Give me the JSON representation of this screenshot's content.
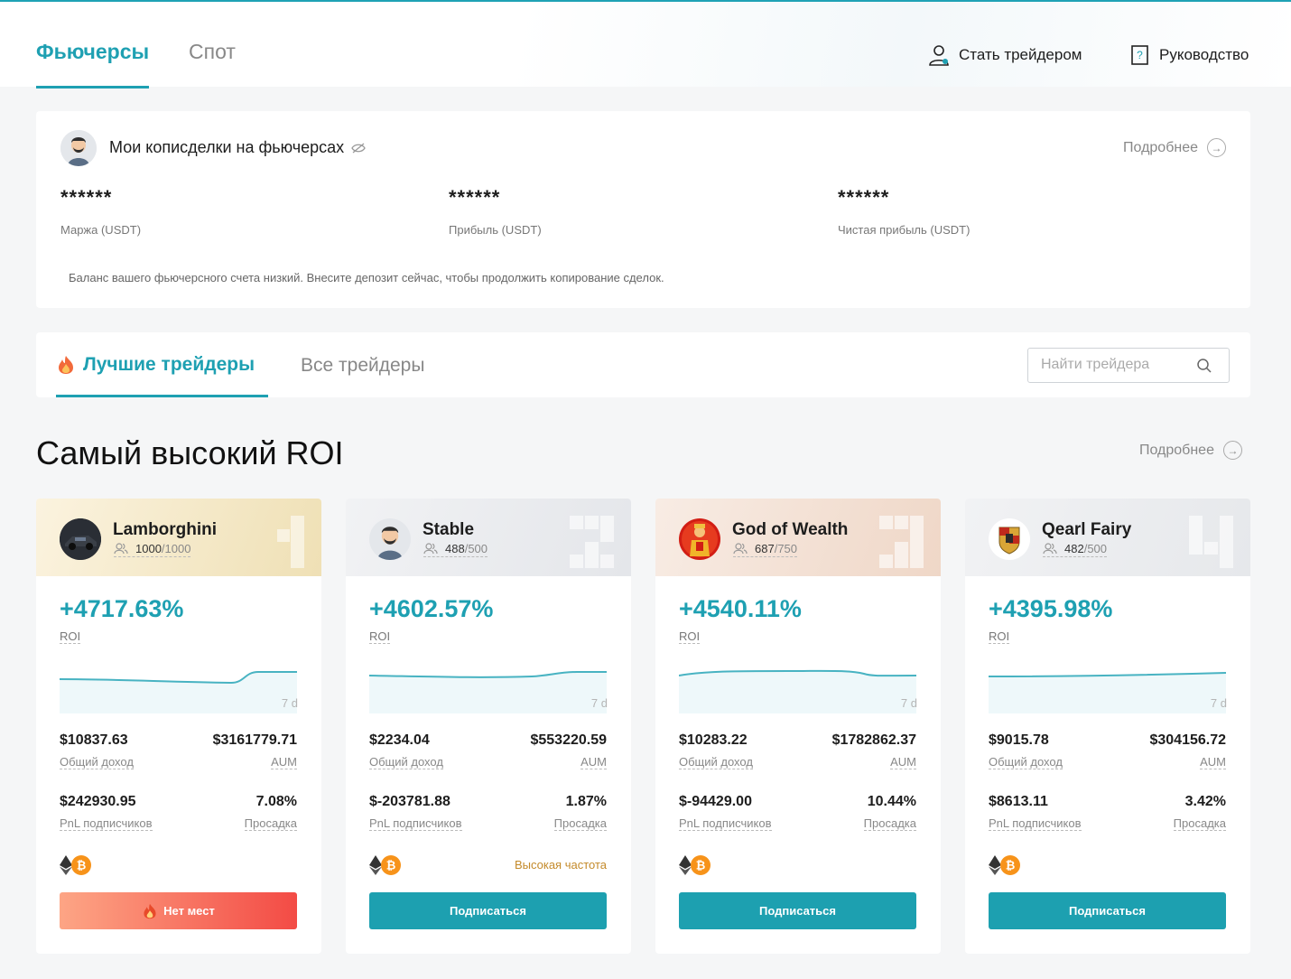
{
  "nav": {
    "futures_tab": "Фьючерсы",
    "spot_tab": "Спот",
    "become_trader": "Стать трейдером",
    "guide": "Руководство"
  },
  "my_copy": {
    "title": "Мои копиcделки на фьючерсах",
    "more": "Подробнее",
    "margin_value": "******",
    "margin_label": "Маржа (USDT)",
    "profit_value": "******",
    "profit_label": "Прибыль (USDT)",
    "net_value": "******",
    "net_label": "Чистая прибыль (USDT)",
    "warning": "Баланс вашего фьючерсного счета низкий. Внесите депозит сейчас, чтобы продолжить копирование сделок."
  },
  "trader_tabs": {
    "best": "Лучшие трейдеры",
    "all": "Все трейдеры",
    "search_placeholder": "Найти трейдера"
  },
  "section": {
    "title": "Самый высокий ROI",
    "more": "Подробнее"
  },
  "labels": {
    "roi": "ROI",
    "period": "7 d",
    "total_income": "Общий доход",
    "aum": "AUM",
    "subscriber_pnl": "PnL подписчиков",
    "drawdown": "Просадка"
  },
  "traders": [
    {
      "name": "Lamborghini",
      "subs_current": "1000",
      "subs_total": "/1000",
      "roi": "+4717.63%",
      "total_income": "$10837.63",
      "aum": "$3161779.71",
      "subscriber_pnl": "$242930.95",
      "drawdown": "7.08%",
      "tag": "",
      "button": "Нет мест",
      "button_state": "full",
      "coins": [
        "eth",
        "btc"
      ]
    },
    {
      "name": "Stable",
      "subs_current": "488",
      "subs_total": "/500",
      "roi": "+4602.57%",
      "total_income": "$2234.04",
      "aum": "$553220.59",
      "subscriber_pnl": "$-203781.88",
      "drawdown": "1.87%",
      "tag": "Высокая частота",
      "button": "Подписаться",
      "button_state": "subscribe",
      "coins": [
        "eth",
        "btc"
      ]
    },
    {
      "name": "God of Wealth",
      "subs_current": "687",
      "subs_total": "/750",
      "roi": "+4540.11%",
      "total_income": "$10283.22",
      "aum": "$1782862.37",
      "subscriber_pnl": "$-94429.00",
      "drawdown": "10.44%",
      "tag": "",
      "button": "Подписаться",
      "button_state": "subscribe",
      "coins": [
        "eth",
        "btc"
      ]
    },
    {
      "name": "Qearl Fairy",
      "subs_current": "482",
      "subs_total": "/500",
      "roi": "+4395.98%",
      "total_income": "$9015.78",
      "aum": "$304156.72",
      "subscriber_pnl": "$8613.11",
      "drawdown": "3.42%",
      "tag": "",
      "button": "Подписаться",
      "button_state": "subscribe",
      "coins": [
        "eth",
        "btc"
      ]
    }
  ],
  "colors": {
    "accent": "#1ea0b2",
    "full_button_start": "#fda585",
    "full_button_end": "#f34b45",
    "tag": "#c48a2a"
  }
}
